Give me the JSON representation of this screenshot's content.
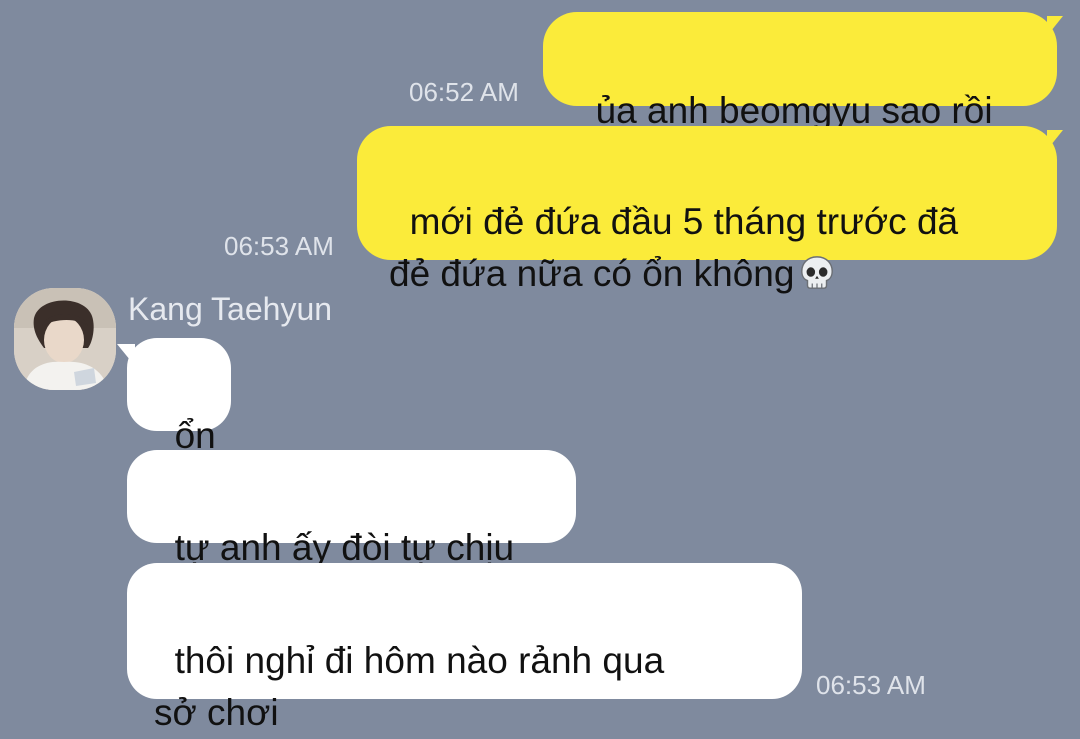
{
  "conversation": {
    "messages": [
      {
        "side": "out",
        "text": "ủa anh beomgyu sao rồi",
        "time": "06:52 AM"
      },
      {
        "side": "out",
        "text": "mới đẻ đứa đầu 5 tháng trước đã\nđẻ đứa nữa có ổn không",
        "emoji": "skull-emoji",
        "time": "06:53 AM"
      }
    ],
    "contact": {
      "name": "Kang Taehyun",
      "avatar": "contact-avatar-photo"
    },
    "replies": [
      {
        "side": "in",
        "text": "ổn"
      },
      {
        "side": "in",
        "text": "tự anh ấy đòi tự chịu"
      },
      {
        "side": "in",
        "text": "thôi nghỉ đi hôm nào rảnh qua\nsở chơi",
        "time": "06:53 AM"
      }
    ]
  },
  "colors": {
    "background": "#7f8a9e",
    "outgoing_bubble": "#fbeb3a",
    "incoming_bubble": "#ffffff",
    "timestamp": "#dfe3ea"
  }
}
